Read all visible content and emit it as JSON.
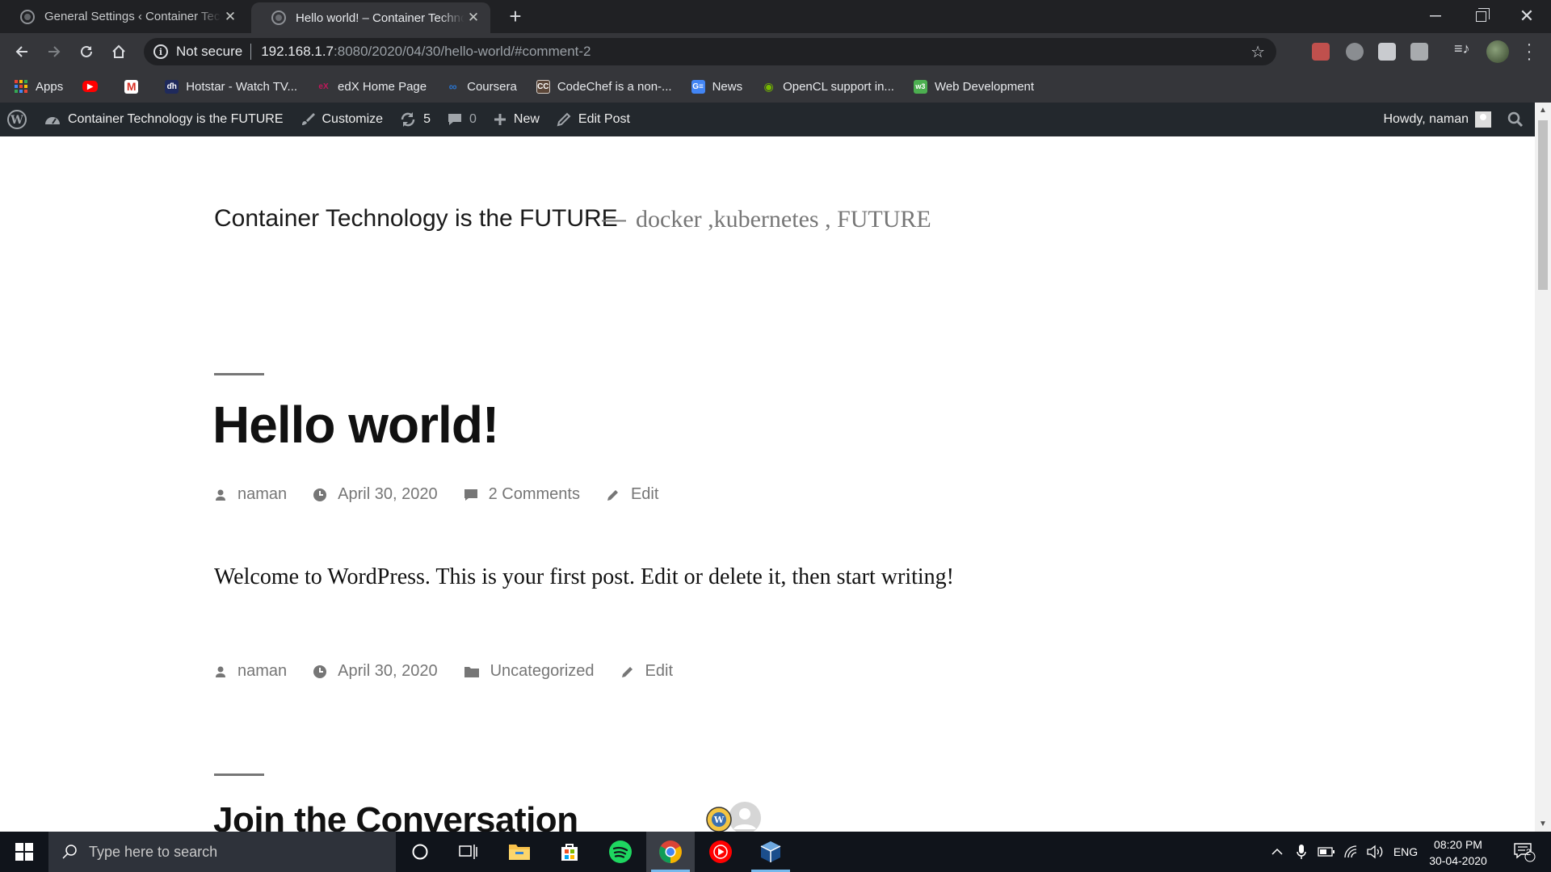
{
  "browser": {
    "tabs": [
      {
        "title": "General Settings ‹ Container Technology is the FUTURE — WordPress",
        "active": false
      },
      {
        "title": "Hello world! – Container Technology is the FUTURE",
        "active": true
      }
    ],
    "url": {
      "security_label": "Not secure",
      "host": "192.168.1.7",
      "path": ":8080/2020/04/30/hello-world/#comment-2"
    },
    "bookmarks": [
      {
        "label": "Apps",
        "icon": "apps-grid-icon"
      },
      {
        "label": "",
        "icon": "youtube-icon",
        "color": "#ff0000"
      },
      {
        "label": "",
        "icon": "gmail-icon",
        "color": "#d93025"
      },
      {
        "label": "Hotstar - Watch TV...",
        "icon": "hotstar-icon",
        "color": "#1f2a5c"
      },
      {
        "label": "edX Home Page",
        "icon": "edx-icon",
        "color": "#9b2a5c"
      },
      {
        "label": "Coursera",
        "icon": "coursera-icon",
        "color": "#2a73cc"
      },
      {
        "label": "CodeChef is a non-...",
        "icon": "codechef-icon",
        "color": "#5b4638"
      },
      {
        "label": "News",
        "icon": "google-news-icon",
        "color": "#4285f4"
      },
      {
        "label": "OpenCL support in...",
        "icon": "nvidia-icon",
        "color": "#76b900"
      },
      {
        "label": "Web Development",
        "icon": "w3-icon",
        "color": "#4caf50"
      }
    ]
  },
  "admin_bar": {
    "site_name": "Container Technology is the FUTURE",
    "customize": "Customize",
    "updates_count": "5",
    "comments_count": "0",
    "new_label": "New",
    "edit_post": "Edit Post",
    "howdy": "Howdy, naman"
  },
  "site": {
    "title": "Container Technology is the FUTURE",
    "dash": "—",
    "description": "docker ,kubernetes , FUTURE"
  },
  "post": {
    "title": "Hello world!",
    "meta_top": {
      "author": "naman",
      "date": "April 30, 2020",
      "comments": "2 Comments",
      "edit": "Edit"
    },
    "body": "Welcome to WordPress. This is your first post. Edit or delete it, then start writing!",
    "meta_bottom": {
      "author": "naman",
      "date": "April 30, 2020",
      "category": "Uncategorized",
      "edit": "Edit"
    }
  },
  "comments": {
    "title": "Join the Conversation"
  },
  "taskbar": {
    "search_placeholder": "Type here to search",
    "language": "ENG",
    "time": "08:20 PM",
    "date": "30-04-2020",
    "notifications": "2"
  },
  "colors": {
    "chrome_dark": "#202124",
    "chrome_toolbar": "#35363a",
    "wp_admin_bar": "#23282d",
    "meta_gray": "#767676",
    "taskbar": "#10141b"
  }
}
